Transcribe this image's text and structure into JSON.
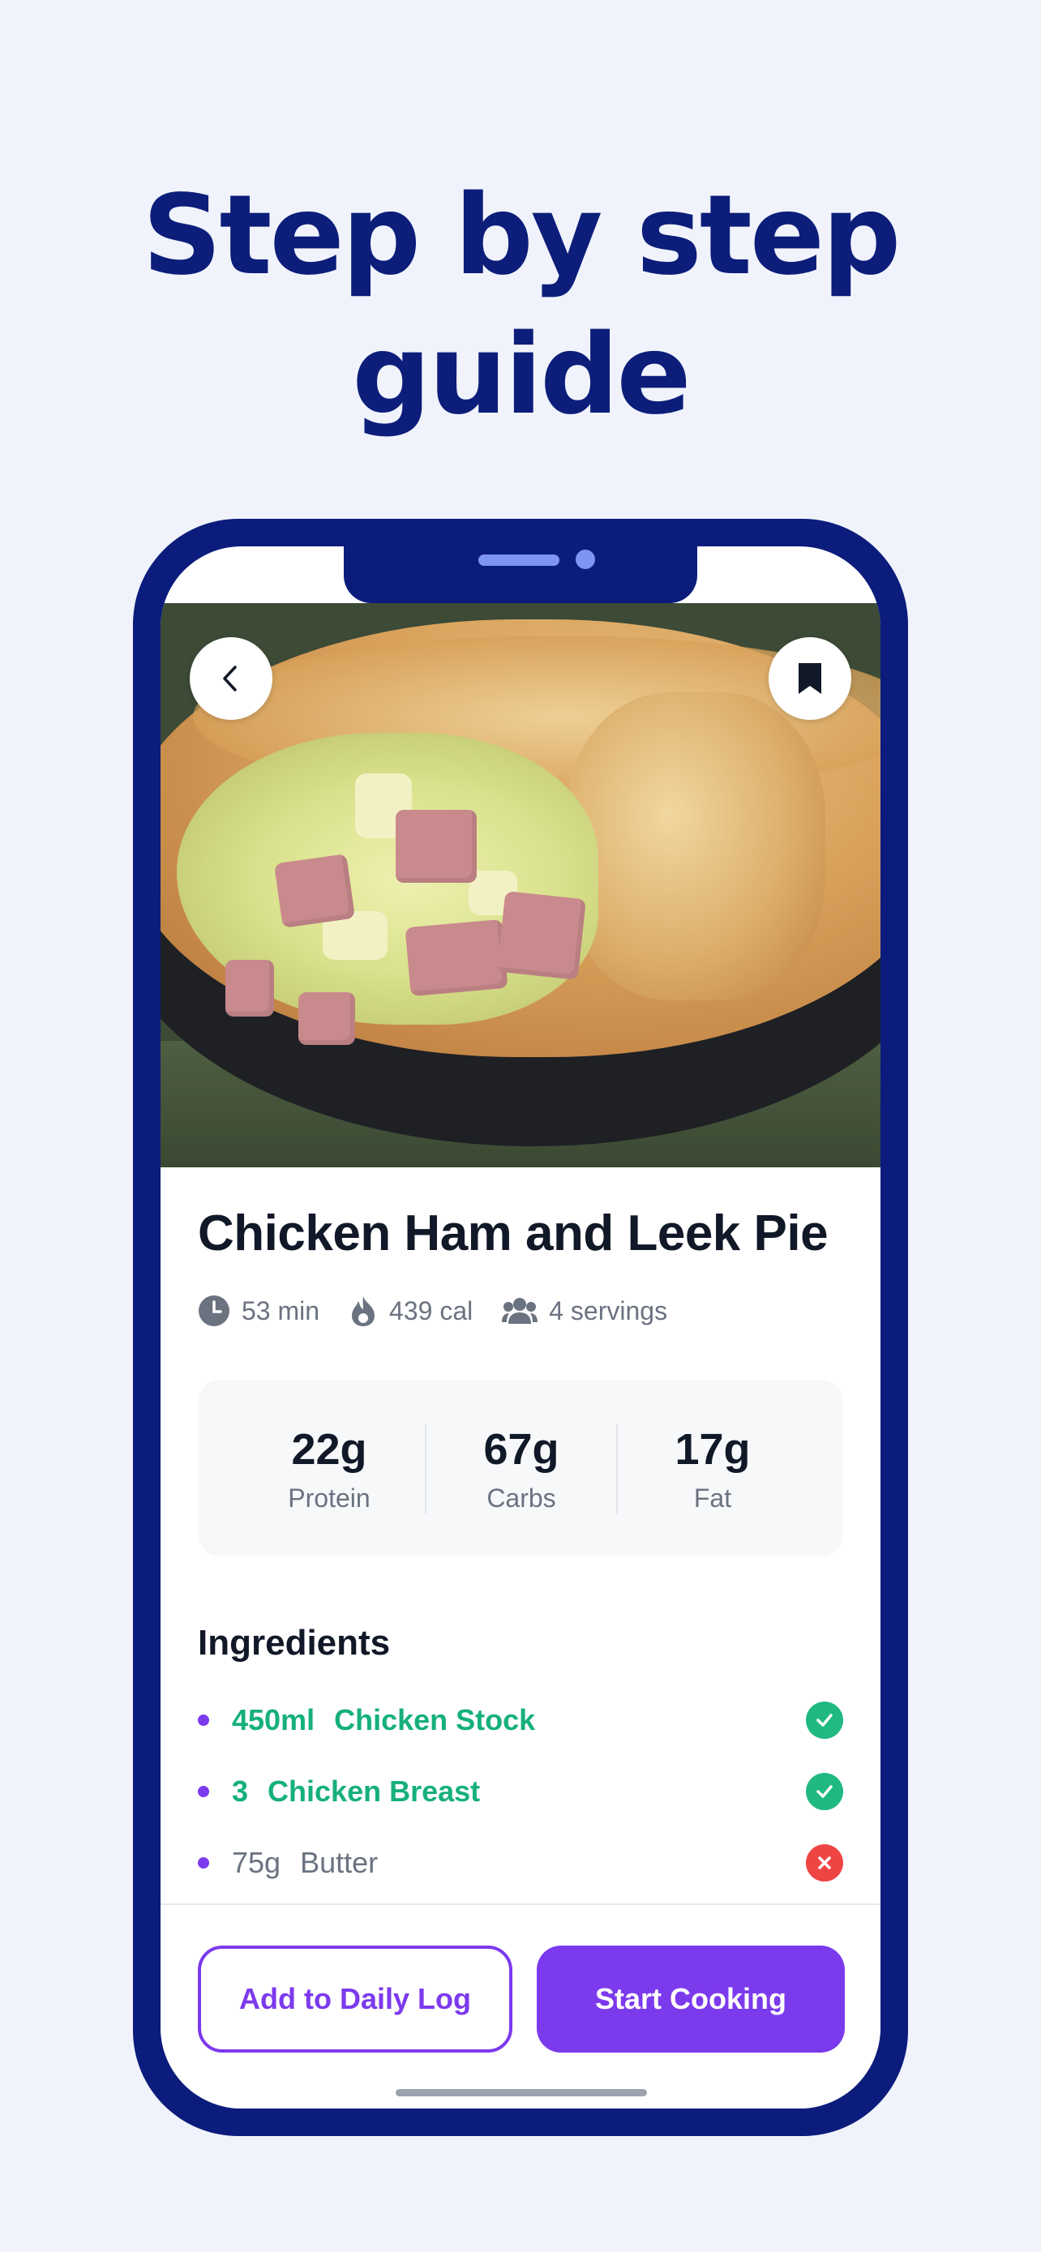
{
  "headline": {
    "line1": "Step by step",
    "line2": "guide"
  },
  "recipe": {
    "title": "Chicken Ham and Leek Pie",
    "time": "53 min",
    "calories": "439 cal",
    "servings": "4 servings"
  },
  "macros": [
    {
      "value": "22g",
      "label": "Protein"
    },
    {
      "value": "67g",
      "label": "Carbs"
    },
    {
      "value": "17g",
      "label": "Fat"
    }
  ],
  "ingredients": {
    "title": "Ingredients",
    "items": [
      {
        "qty": "450ml",
        "name": "Chicken Stock",
        "status": "check-icon"
      },
      {
        "qty": "3",
        "name": "Chicken Breast",
        "status": "check-icon"
      },
      {
        "qty": "75g",
        "name": "Butter",
        "status": "x-icon"
      }
    ]
  },
  "actions": {
    "add_log": "Add to Daily Log",
    "start_cooking": "Start Cooking"
  },
  "colors": {
    "brand_navy": "#0c1d7a",
    "accent_purple": "#7c3aed",
    "success_green": "#1fb981",
    "error_red": "#ef4444"
  }
}
